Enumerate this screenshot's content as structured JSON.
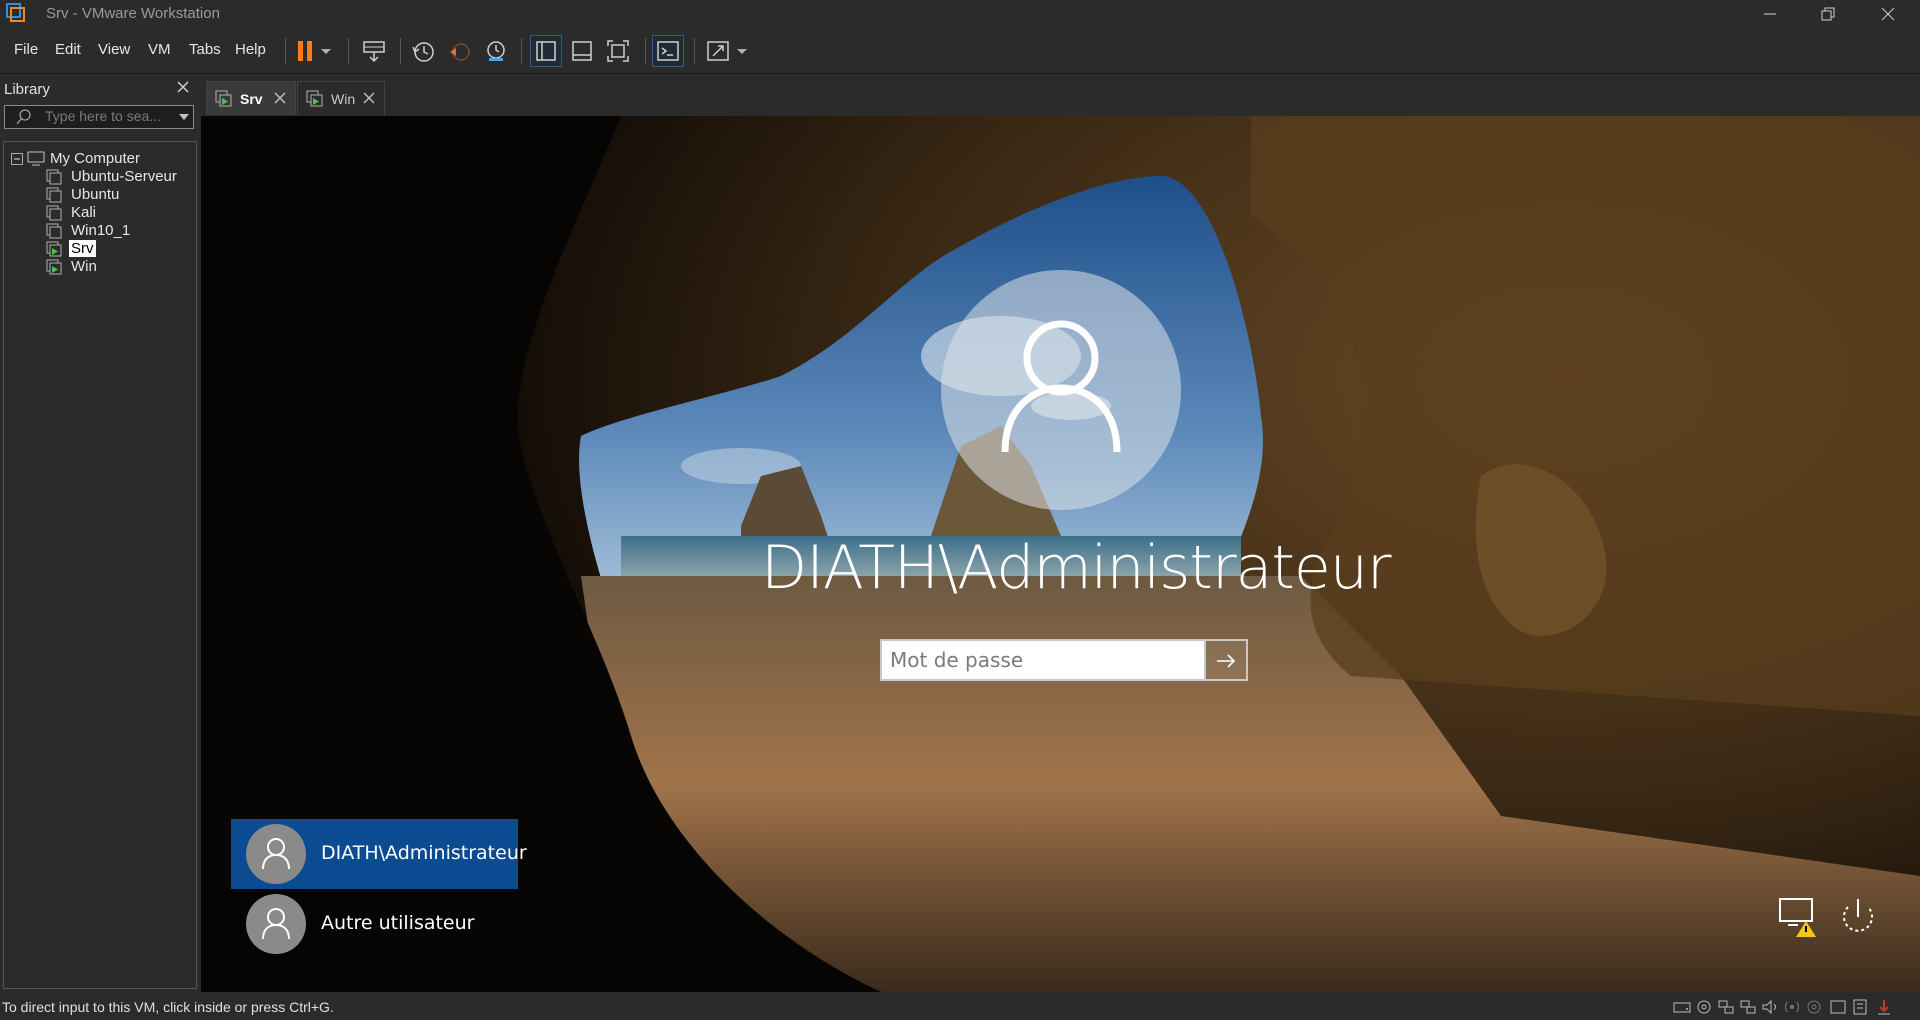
{
  "window": {
    "title": "Srv - VMware Workstation"
  },
  "menu": {
    "items": [
      "File",
      "Edit",
      "View",
      "VM",
      "Tabs",
      "Help"
    ]
  },
  "toolbar": {
    "buttons": [
      "pause-icon",
      "dropdown-arrow-icon",
      "send-ctrl-alt-del-icon",
      "snapshot-icon",
      "revert-snapshot-icon",
      "snapshot-manager-icon",
      "show-library-icon",
      "thumbnail-bar-icon",
      "full-screen-icon",
      "console-view-icon",
      "stretch-guest-icon",
      "dropdown-arrow-icon"
    ],
    "accent_pause": "#ff7a1a"
  },
  "library": {
    "title": "Library",
    "search_placeholder": "Type here to sea...",
    "root": "My Computer",
    "vms": [
      {
        "name": "Ubuntu-Serveur",
        "running": false
      },
      {
        "name": "Ubuntu",
        "running": false
      },
      {
        "name": "Kali",
        "running": false
      },
      {
        "name": "Win10_1",
        "running": false
      },
      {
        "name": "Srv",
        "running": true,
        "selected": true
      },
      {
        "name": "Win",
        "running": true
      }
    ]
  },
  "tabs": [
    {
      "label": "Srv",
      "active": true
    },
    {
      "label": "Win",
      "active": false
    }
  ],
  "vm_screen": {
    "username": "DIATH\\Administrateur",
    "password_placeholder": "Mot de passe",
    "users": [
      {
        "name": "DIATH\\Administrateur",
        "selected": true
      },
      {
        "name": "Autre utilisateur",
        "selected": false
      }
    ],
    "selected_color": "#0b4b91"
  },
  "status_bar": {
    "message": "To direct input to this VM, click inside or press Ctrl+G."
  }
}
